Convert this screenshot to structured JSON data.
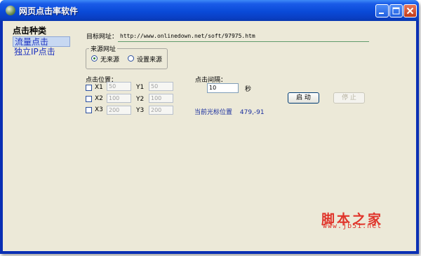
{
  "window": {
    "title": "网页点击率软件",
    "controls": [
      "minimize",
      "maximize",
      "close"
    ],
    "colors": {
      "titlebar": "#0a4ad8",
      "client": "#ece9d8"
    }
  },
  "sidebar": {
    "title": "点击种类",
    "items": [
      {
        "label": "流量点击",
        "selected": true
      },
      {
        "label": "独立IP点击",
        "selected": false
      }
    ]
  },
  "target": {
    "label": "目标网址：",
    "url": "http://www.onlinedown.net/soft/97975.htm"
  },
  "source": {
    "group_label": "来源网址",
    "options": [
      {
        "label": "无来源",
        "selected": true
      },
      {
        "label": "设置来源",
        "selected": false
      }
    ]
  },
  "click_position": {
    "label": "点击位置：",
    "rows": [
      {
        "x_label": "X1",
        "x_value": "50",
        "y_label": "Y1",
        "y_value": "50",
        "checked": false
      },
      {
        "x_label": "X2",
        "x_value": "100",
        "y_label": "Y2",
        "y_value": "100",
        "checked": false
      },
      {
        "x_label": "X3",
        "x_value": "200",
        "y_label": "Y3",
        "y_value": "200",
        "checked": false
      }
    ]
  },
  "interval": {
    "label": "点击间隔：",
    "value": "10",
    "unit": "秒"
  },
  "buttons": {
    "start": "启 动",
    "stop": "停 止"
  },
  "cursor": {
    "label": "当前光标位置",
    "value": "479,-91"
  },
  "watermark": {
    "text": "脚本之家",
    "url": "www.jb51.net",
    "color": "#e0342a"
  }
}
